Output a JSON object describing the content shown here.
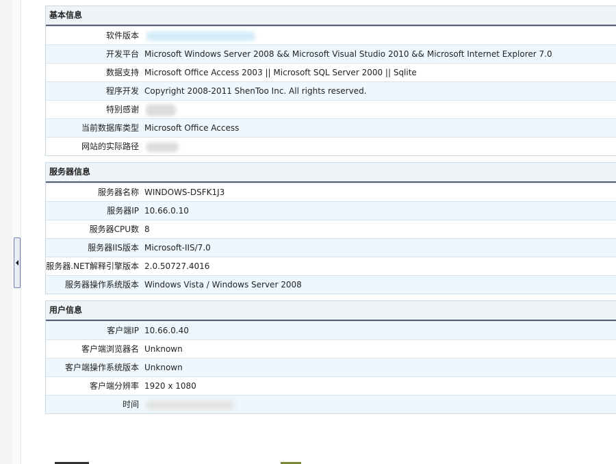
{
  "sections": [
    {
      "title": "基本信息",
      "rows": [
        {
          "label": "软件版本",
          "value": ""
        },
        {
          "label": "开发平台",
          "value": "Microsoft Windows Server 2008 && Microsoft Visual Studio 2010 && Microsoft Internet Explorer 7.0"
        },
        {
          "label": "数据支持",
          "value": "Microsoft Office Access 2003 || Microsoft SQL Server 2000 || Sqlite"
        },
        {
          "label": "程序开发",
          "value": "Copyright 2008-2011 ShenToo Inc. All rights reserved."
        },
        {
          "label": "特别感谢",
          "value": ""
        },
        {
          "label": "当前数据库类型",
          "value": "Microsoft Office Access"
        },
        {
          "label": "网站的实际路径",
          "value": ""
        }
      ]
    },
    {
      "title": "服务器信息",
      "rows": [
        {
          "label": "服务器名称",
          "value": "WINDOWS-DSFK1J3"
        },
        {
          "label": "服务器IP",
          "value": "10.66.0.10"
        },
        {
          "label": "服务器CPU数",
          "value": "8"
        },
        {
          "label": "服务器IIS版本",
          "value": "Microsoft-IIS/7.0"
        },
        {
          "label": "服务器.NET解释引擎版本",
          "value": "2.0.50727.4016"
        },
        {
          "label": "服务器操作系统版本",
          "value": "Windows Vista / Windows Server 2008"
        }
      ]
    },
    {
      "title": "用户信息",
      "rows": [
        {
          "label": "客户端IP",
          "value": "10.66.0.40"
        },
        {
          "label": "客户端浏览器名",
          "value": "Unknown"
        },
        {
          "label": "客户端操作系统版本",
          "value": "Unknown"
        },
        {
          "label": "客户端分辨率",
          "value": "1920 x 1080"
        },
        {
          "label": "时间",
          "value": ""
        }
      ]
    }
  ],
  "colors": {
    "header_bg": "#eef3f7",
    "header_rule": "#555e75",
    "row_alt_bg": "#eef7fd",
    "row_border": "#d6e3ec"
  }
}
